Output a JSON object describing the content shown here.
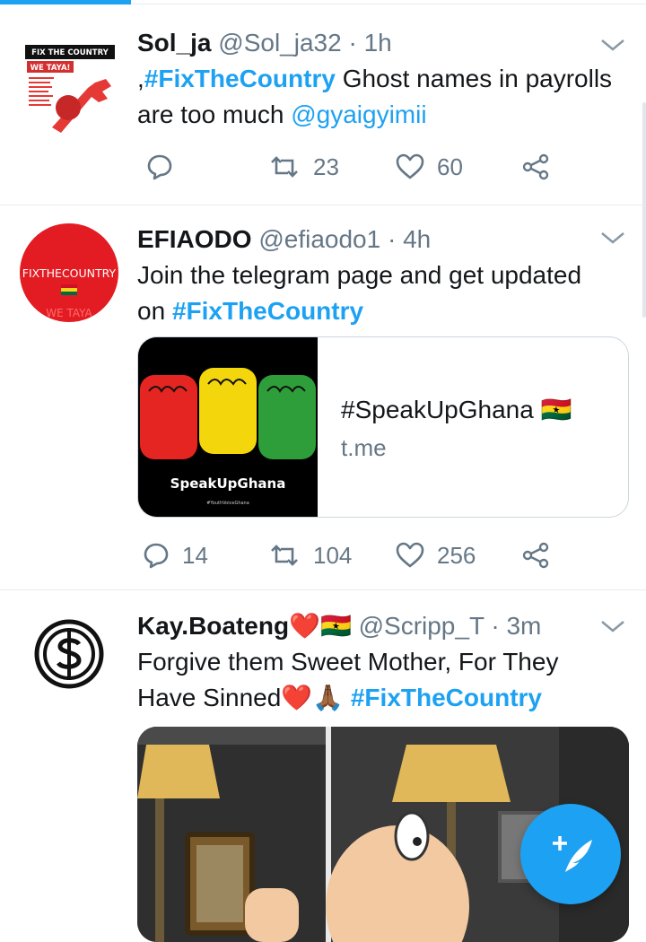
{
  "tweets": [
    {
      "name": "Sol_ja",
      "handle": "@Sol_ja32",
      "separator": "·",
      "time": "1h",
      "text_prefix": ",",
      "hashtag": "#FixTheCountry",
      "text_middle": " Ghost names in payrolls are too much ",
      "mention": "@gyaigyimii",
      "avatar_text_line1": "FIX THE COUNTRY",
      "avatar_text_line2": "WE TAYA!",
      "reply_count": "",
      "retweet_count": "23",
      "like_count": "60"
    },
    {
      "name": "EFIAODO",
      "handle": "@efiaodo1",
      "separator": "·",
      "time": "4h",
      "text": "Join the telegram page and get updated on ",
      "hashtag": "#FixTheCountry",
      "avatar_text": "FIXTHECOUNTRY",
      "avatar_text_faded": "WE TAYA",
      "card": {
        "title": "#SpeakUpGhana 🇬🇭",
        "domain": "t.me",
        "image_caption": "SpeakUpGhana",
        "image_subcaption": "#YouthVoiceGhana"
      },
      "reply_count": "14",
      "retweet_count": "104",
      "like_count": "256"
    },
    {
      "name": "Kay.Boateng",
      "name_emoji": "❤️🇬🇭",
      "handle": "@Scripp_T",
      "separator": "·",
      "time": "3m",
      "text": "Forgive them Sweet Mother, For They Have Sinned",
      "text_emoji": "❤️🙏🏾",
      "hashtag": "#FixTheCountry"
    }
  ],
  "colors": {
    "accent": "#1da1f2",
    "text": "#14171a",
    "secondary": "#657786",
    "divider": "#e6ecf0"
  },
  "icons": [
    "reply-icon",
    "retweet-icon",
    "like-icon",
    "share-icon",
    "chevron-down-icon",
    "compose-tweet-icon"
  ]
}
